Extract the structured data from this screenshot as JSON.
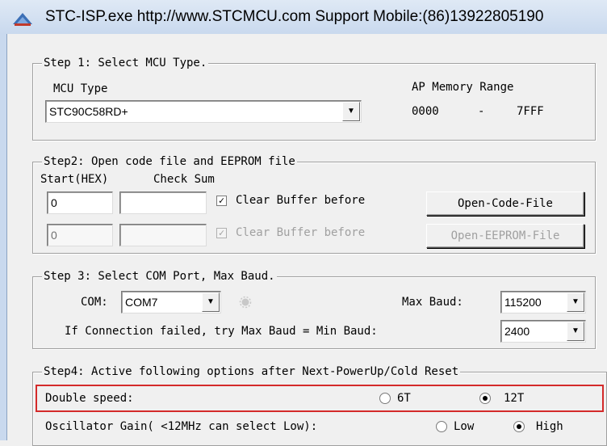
{
  "window": {
    "title": "STC-ISP.exe  http://www.STCMCU.com  Support Mobile:(86)13922805190"
  },
  "step1": {
    "legend": "Step 1: Select MCU Type.",
    "mcu_type_label": "MCU Type",
    "mcu_value": "STC90C58RD+",
    "ap_memory_label": "AP Memory Range",
    "ap_start": "0000",
    "ap_dash": "-",
    "ap_end": "7FFF"
  },
  "step2": {
    "legend": "Step2: Open code file and EEPROM file",
    "start_hex_label": "Start(HEX)",
    "check_sum_label": "Check Sum",
    "row1": {
      "start": "0",
      "checksum": "",
      "clear_label": "Clear Buffer before",
      "checked": true,
      "button": "Open-Code-File"
    },
    "row2": {
      "start": "0",
      "checksum": "",
      "clear_label": "Clear Buffer before",
      "checked": true,
      "button": "Open-EEPROM-File"
    }
  },
  "step3": {
    "legend": "Step 3: Select COM Port, Max Baud.",
    "com_label": "COM:",
    "com_value": "COM7",
    "max_baud_label": "Max Baud:",
    "max_baud_value": "115200",
    "fail_text": "If Connection failed, try Max Baud = Min Baud:",
    "min_baud_value": "2400"
  },
  "step4": {
    "legend": "Step4: Active following options after Next-PowerUp/Cold Reset",
    "double_speed_label": "Double speed:",
    "opt_6t": "6T",
    "opt_12t": "12T",
    "double_speed_selected": "12T",
    "osc_label": "Oscillator Gain( <12MHz can select Low):",
    "opt_low": "Low",
    "opt_high": "High",
    "osc_selected": "High"
  },
  "colors": {
    "highlight": "#d42a2a",
    "titlebar": "#c9d9ee",
    "window_bg": "#f0f0f0"
  }
}
